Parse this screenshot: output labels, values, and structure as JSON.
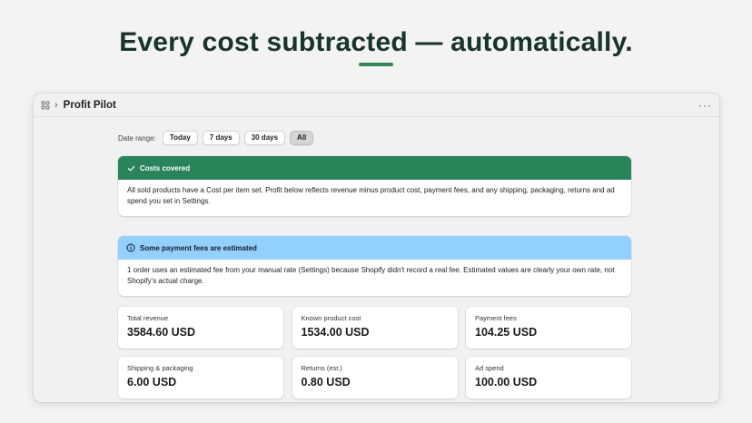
{
  "headline": "Every cost subtracted — automatically.",
  "window": {
    "title": "Profit Pilot",
    "app_icon": "grid-apps-icon",
    "more_icon": "ellipsis-icon",
    "more_label": "···"
  },
  "date_range": {
    "label": "Date range:",
    "options": [
      "Today",
      "7 days",
      "30 days",
      "All"
    ],
    "selected": "All"
  },
  "banners": {
    "costs": {
      "title": "Costs covered",
      "icon": "checkmark-icon",
      "body": "All sold products have a Cost per item set. Profit below reflects revenue minus product cost, payment fees, and any shipping, packaging, returns and ad spend you set in Settings.",
      "color": "#29845a"
    },
    "fees": {
      "title": "Some payment fees are estimated",
      "icon": "info-icon",
      "body": "1 order uses an estimated fee from your manual rate (Settings) because Shopify didn't record a real fee. Estimated values are clearly your own rate, not Shopify's actual charge.",
      "color": "#91d0ff"
    }
  },
  "metrics": [
    {
      "label": "Total revenue",
      "value": "3584.60 USD"
    },
    {
      "label": "Known product cost",
      "value": "1534.00 USD"
    },
    {
      "label": "Payment fees",
      "value": "104.25 USD"
    },
    {
      "label": "Shipping & packaging",
      "value": "6.00 USD"
    },
    {
      "label": "Returns (est.)",
      "value": "0.80 USD"
    },
    {
      "label": "Ad spend",
      "value": "100.00 USD"
    }
  ],
  "colors": {
    "accent": "#2e8a5a",
    "headline": "#17352a"
  }
}
